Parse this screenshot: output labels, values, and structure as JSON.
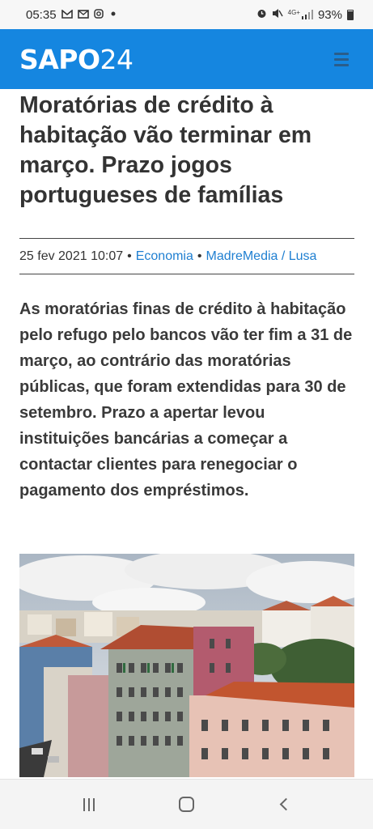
{
  "status_bar": {
    "time": "05:35",
    "notification_icons": [
      "gmail-icon",
      "mail-icon",
      "instagram-icon",
      "dot-icon"
    ],
    "network_label": "4G+",
    "battery": "93%"
  },
  "header": {
    "logo_bold": "SAPO",
    "logo_light": "24",
    "menu_icon": "hamburger-icon"
  },
  "article": {
    "title": "Moratórias de crédito à habitação vão terminar em março. Prazo jogos portugueses de famílias",
    "date": "25 fev 2021 10:07",
    "separator": "•",
    "category": "Economia",
    "source": "MadreMedia / Lusa",
    "lead": "As moratórias finas de crédito à habitação pelo refugo pelo bancos vão ter fim a 31 de março, ao contrário das moratórias públicas, que foram extendidas para 30 de setembro. Prazo a apertar levou instituições bancárias a começar a contactar clientes para renegociar o pagamento dos empréstimos."
  },
  "colors": {
    "brand_blue": "#1586e0",
    "link_blue": "#1f7fd1"
  },
  "nav_bar": {
    "buttons": [
      "recents-icon",
      "home-icon",
      "back-icon"
    ]
  }
}
